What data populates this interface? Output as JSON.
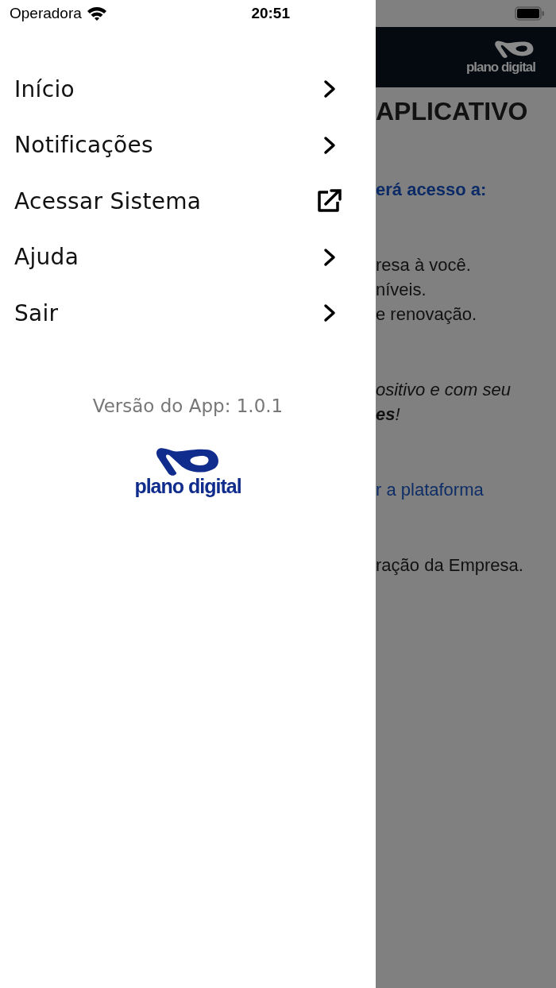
{
  "status_bar": {
    "carrier": "Operadora",
    "time": "20:51"
  },
  "menu": {
    "items": [
      {
        "label": "Início",
        "kind": "chevron"
      },
      {
        "label": "Notificações",
        "kind": "chevron"
      },
      {
        "label": "Acessar Sistema",
        "kind": "external"
      },
      {
        "label": "Ajuda",
        "kind": "chevron"
      },
      {
        "label": "Sair",
        "kind": "chevron"
      }
    ],
    "version": "Versão do App: 1.0.1",
    "logo_text": "plano digital"
  },
  "background_page": {
    "header_logo_text": "plano digital",
    "title": "APLICATIVO",
    "paragraphs": [
      {
        "kind": "heading",
        "lines": [
          "erá acesso a:"
        ]
      },
      {
        "kind": "body",
        "lines": [
          "resa à você.",
          "níveis.",
          "e renovação."
        ]
      },
      {
        "kind": "italic",
        "lines": [
          "ositivo e com seu",
          "**es**!"
        ]
      },
      {
        "kind": "link",
        "lines": [
          "r a plataforma"
        ]
      },
      {
        "kind": "body",
        "lines": [
          "ração da Empresa."
        ]
      }
    ]
  }
}
